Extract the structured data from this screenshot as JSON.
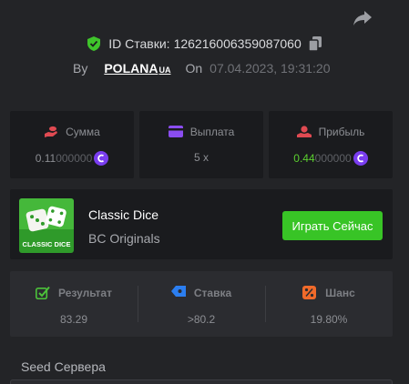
{
  "header": {
    "bet_id_label": "ID Ставки:",
    "bet_id": "126216006359087060",
    "by_label": "By",
    "username": "POLANA",
    "username_suffix": "UA",
    "on_label": "On",
    "datetime": "07.04.2023, 19:31:20"
  },
  "stats": {
    "amount": {
      "label": "Сумма",
      "value_main": "0.11",
      "value_dim": "000000",
      "icon": "money-hand-icon"
    },
    "payout": {
      "label": "Выплата",
      "value": "5 x",
      "icon": "wallet-card-icon"
    },
    "profit": {
      "label": "Прибыль",
      "value_main": "0.44",
      "value_dim": "000000",
      "icon": "profit-hand-icon"
    }
  },
  "game": {
    "thumb_text": "CLASSIC DICE",
    "title": "Classic Dice",
    "provider": "BC Originals",
    "play_label": "Играть Сейчас"
  },
  "results": {
    "result": {
      "label": "Результат",
      "value": "83.29",
      "icon": "result-check-icon"
    },
    "bet": {
      "label": "Ставка",
      "value": ">80.2",
      "icon": "bet-tag-icon"
    },
    "chance": {
      "label": "Шанс",
      "value": "19.80%",
      "icon": "percent-icon"
    }
  },
  "seed": {
    "label": "Seed Сервера"
  },
  "colors": {
    "background": "#232427",
    "card": "#1a1b1e",
    "accent_green": "#38c426",
    "profit_green": "#5bd02f",
    "coin_purple": "#7a3df0"
  }
}
